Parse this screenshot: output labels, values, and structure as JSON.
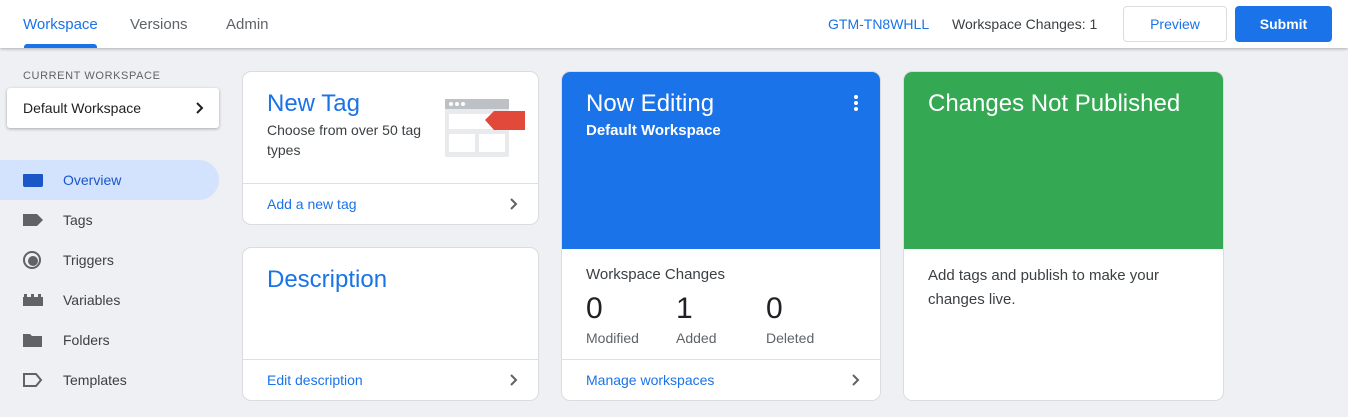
{
  "header": {
    "tabs": [
      {
        "label": "Workspace",
        "active": true
      },
      {
        "label": "Versions",
        "active": false
      },
      {
        "label": "Admin",
        "active": false
      }
    ],
    "container_id": "GTM-TN8WHLL",
    "workspace_changes": "Workspace Changes: 1",
    "preview_label": "Preview",
    "submit_label": "Submit",
    "accent_color": "#1a73e8"
  },
  "sidebar": {
    "current_workspace_label": "CURRENT WORKSPACE",
    "workspace_name": "Default Workspace",
    "items": [
      {
        "label": "Overview",
        "icon": "overview-icon",
        "active": true
      },
      {
        "label": "Tags",
        "icon": "tag-icon",
        "active": false
      },
      {
        "label": "Triggers",
        "icon": "trigger-icon",
        "active": false
      },
      {
        "label": "Variables",
        "icon": "variables-icon",
        "active": false
      },
      {
        "label": "Folders",
        "icon": "folder-icon",
        "active": false
      },
      {
        "label": "Templates",
        "icon": "template-icon",
        "active": false
      }
    ]
  },
  "cards": {
    "new_tag": {
      "title": "New Tag",
      "description": "Choose from over 50 tag types",
      "link": "Add a new tag",
      "icon": "tag-illustration-icon"
    },
    "description": {
      "title": "Description",
      "link": "Edit description"
    },
    "now_editing": {
      "title": "Now Editing",
      "subtitle": "Default Workspace",
      "color": "#1a73e8",
      "changes_title": "Workspace Changes",
      "stats": [
        {
          "value": "0",
          "label": "Modified"
        },
        {
          "value": "1",
          "label": "Added"
        },
        {
          "value": "0",
          "label": "Deleted"
        }
      ],
      "link": "Manage workspaces"
    },
    "not_published": {
      "title": "Changes Not Published",
      "text": "Add tags and publish to make your changes live.",
      "color": "#34a853"
    }
  }
}
